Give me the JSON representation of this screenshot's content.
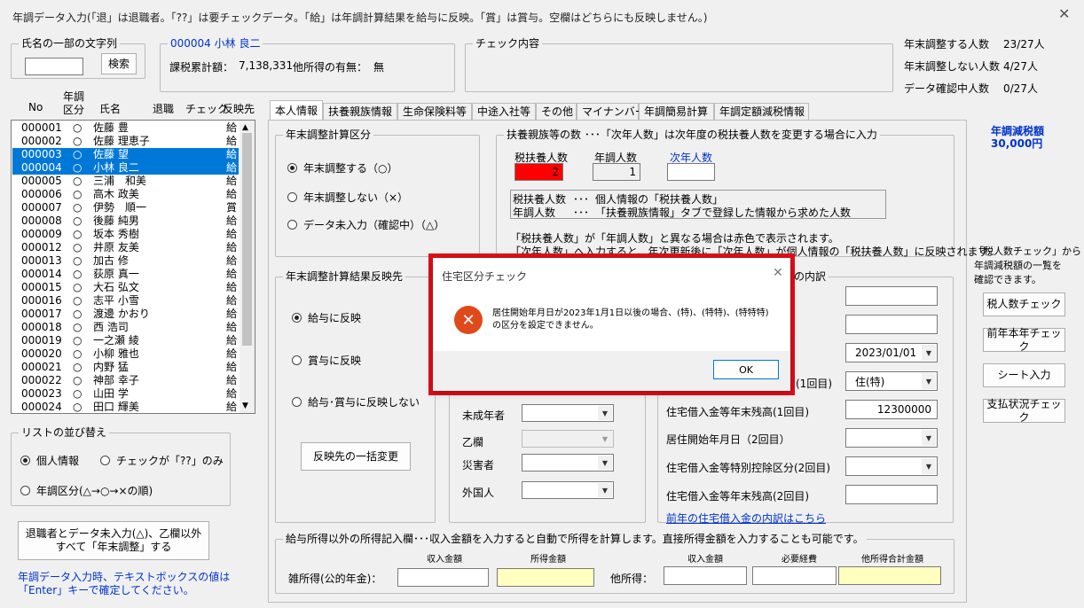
{
  "window": {
    "title": "年調データ入力(「退」は退職者。「??」は要チェックデータ。「給」は年調計算結果を給与に反映。「賞」は賞与。空欄はどちらにも反映しません。)"
  },
  "name_search": {
    "legend": "氏名の一部の文字列",
    "value": "",
    "button": "検索"
  },
  "employee": {
    "legend": "000004  小林 良二",
    "taxable_label": "課税累計額：",
    "taxable_value": "7,138,331",
    "other_income_label": "他所得の有無：",
    "other_income_value": "無"
  },
  "check_contents": {
    "legend": "チェック内容"
  },
  "stats": {
    "rows": [
      {
        "label": "年末調整する人数",
        "value": "23/27人"
      },
      {
        "label": "年末調整しない人数",
        "value": "4/27人"
      },
      {
        "label": "データ確認中人数",
        "value": "0/27人"
      }
    ]
  },
  "list": {
    "headers": {
      "no": "No",
      "kubun_l1": "年調",
      "kubun_l2": "区分",
      "name": "氏名",
      "retired": "退職",
      "check": "チェック",
      "dest": "反映先"
    },
    "rows": [
      {
        "no": "000001",
        "k": "○",
        "name": "佐藤 豊",
        "dest": "給"
      },
      {
        "no": "000002",
        "k": "○",
        "name": "佐藤 理恵子",
        "dest": "給"
      },
      {
        "no": "000003",
        "k": "○",
        "name": "佐藤 望",
        "dest": "給"
      },
      {
        "no": "000004",
        "k": "○",
        "name": "小林 良二",
        "dest": "給"
      },
      {
        "no": "000005",
        "k": "○",
        "name": "三浦　和美",
        "dest": "給"
      },
      {
        "no": "000006",
        "k": "○",
        "name": "高木 政美",
        "dest": "給"
      },
      {
        "no": "000007",
        "k": "○",
        "name": "伊勢　順一",
        "dest": "賞"
      },
      {
        "no": "000008",
        "k": "○",
        "name": "後藤 純男",
        "dest": "給"
      },
      {
        "no": "000009",
        "k": "○",
        "name": "坂本 秀樹",
        "dest": "給"
      },
      {
        "no": "000012",
        "k": "○",
        "name": "井原 友美",
        "dest": "給"
      },
      {
        "no": "000013",
        "k": "○",
        "name": "加古 修",
        "dest": "給"
      },
      {
        "no": "000014",
        "k": "○",
        "name": "荻原 真一",
        "dest": "給"
      },
      {
        "no": "000015",
        "k": "○",
        "name": "大石 弘文",
        "dest": "給"
      },
      {
        "no": "000016",
        "k": "○",
        "name": "志平 小雪",
        "dest": "給"
      },
      {
        "no": "000017",
        "k": "○",
        "name": "渡邊 かおり",
        "dest": "給"
      },
      {
        "no": "000018",
        "k": "○",
        "name": "西 浩司",
        "dest": "給"
      },
      {
        "no": "000019",
        "k": "○",
        "name": "一之瀬 綾",
        "dest": "給"
      },
      {
        "no": "000020",
        "k": "○",
        "name": "小柳 雅也",
        "dest": "給"
      },
      {
        "no": "000021",
        "k": "○",
        "name": "内野 猛",
        "dest": "給"
      },
      {
        "no": "000022",
        "k": "○",
        "name": "神部 幸子",
        "dest": "給"
      },
      {
        "no": "000023",
        "k": "○",
        "name": "山田 学",
        "dest": "給"
      },
      {
        "no": "000024",
        "k": "○",
        "name": "田口 輝美",
        "dest": "給"
      }
    ]
  },
  "sort": {
    "legend": "リストの並び替え",
    "opt1": "個人情報",
    "opt2": "チェックが「??」のみ",
    "opt3": "年調区分(△→○→×の順)"
  },
  "bulk_button": {
    "line1": "退職者とデータ未入力(△)、乙欄以外",
    "line2": "すべて「年末調整」する"
  },
  "note": {
    "line1": "年調データ入力時、テキストボックスの値は",
    "line2": "「Enter」キーで確定してください。"
  },
  "tabs": [
    "本人情報",
    "扶養親族情報",
    "生命保険料等",
    "中途入社等",
    "その他",
    "マイナンバー",
    "年調簡易計算",
    "年調定額減税情報"
  ],
  "nencho_kubun": {
    "legend": "年末調整計算区分",
    "opt1": "年末調整する（○）",
    "opt2": "年末調整しない（×）",
    "opt3": "データ未入力（確認中）（△）"
  },
  "fuyou": {
    "legend": "扶養親族等の数 ･･･「次年人数」は次年度の税扶養人数を変更する場合に入力",
    "h1": "税扶養人数",
    "h2": "年調人数",
    "h3": "次年人数",
    "v1": "2",
    "v2": "1",
    "v3": "",
    "exp1a": "税扶養人数",
    "exp1b": "･･･",
    "exp1c": "個人情報の「税扶養人数」",
    "exp2a": "年調人数",
    "exp2b": "･･･",
    "exp2c": "「扶養親族情報」タブで登録した情報から求めた人数",
    "note1": "「税扶養人数」が「年調人数」と異なる場合は赤色で表示されます。",
    "note2": "「次年人数」へ入力すると、年次更新後に「次年人数」が個人情報の「税扶養人数」に反映されます。"
  },
  "hanei": {
    "legend": "年末調整計算結果反映先",
    "opt1": "給与に反映",
    "opt2": "賞与に反映",
    "opt3": "給与･賞与に反映しない",
    "button": "反映先の一括変更"
  },
  "tokubetsu": {
    "miseinen": "未成年者",
    "otsu": "乙欄",
    "saigai": "災害者",
    "gaikoku": "外国人"
  },
  "jutaku": {
    "legend_tail": "の内訳",
    "date1": "2023/01/01",
    "kubun1_label": "(1回目)",
    "kubun1": "住(特)",
    "zandaka1_label": "住宅借入金等年末残高(1回目)",
    "zandaka1": "12300000",
    "date2_label": "居住開始年月日（2回目）",
    "kubun2_label": "住宅借入金等特別控除区分(2回目)",
    "zandaka2_label": "住宅借入金等年末残高(2回目)",
    "link": "前年の住宅借入金の内訳はこちら"
  },
  "side": {
    "gentai_title": "年調減税額",
    "gentai_value": "30,000円",
    "desc1": "「税人数チェック」から",
    "desc2": "年調減税額の一覧を",
    "desc3": "確認できます。",
    "b1": "税人数チェック",
    "b2": "前年本年チェック",
    "b3": "シート入力",
    "b4": "支払状況チェック"
  },
  "other_income": {
    "legend": "給与所得以外の所得記入欄･･･収入金額を入力すると自動で所得を計算します。直接所得金額を入力することも可能です。",
    "h_income1": "収入金額",
    "h_shotoku": "所得金額",
    "h_income2": "収入金額",
    "h_keihi": "必要経費",
    "h_total": "他所得合計金額",
    "pension_label": "雑所得(公的年金)：",
    "other_label": "他所得："
  },
  "dialog": {
    "title": "住宅区分チェック",
    "msg1": "居住開始年月日が2023年1月1日以後の場合、(特)、(特特)、(特特特)",
    "msg2": "の区分を設定できません。",
    "ok": "OK"
  },
  "colors": {
    "highlight_border": "#e0101a",
    "selection": "#0078d7",
    "error_icon": "#e04a1a",
    "red_cell": "#ff0000",
    "yellow_cell": "#ffffc0"
  }
}
